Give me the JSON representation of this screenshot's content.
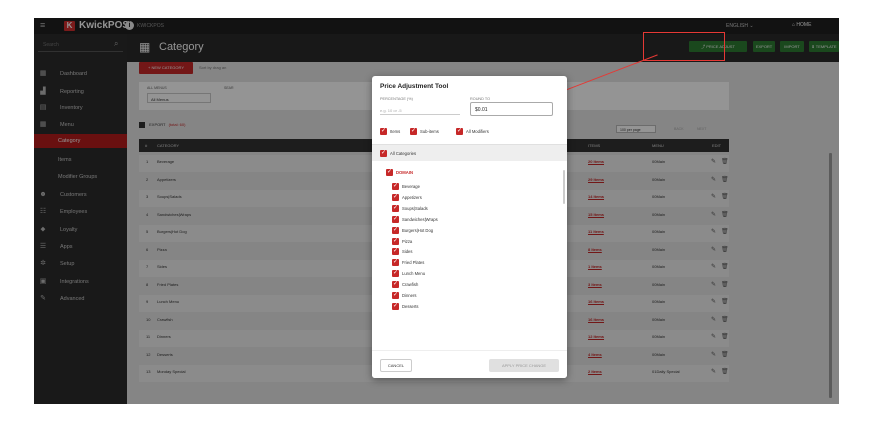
{
  "topbar": {
    "brand": "KwickPOS",
    "store": "KWICKPOS",
    "language": "ENGLISH ⌄",
    "home": "HOME"
  },
  "sidebar": {
    "search_placeholder": "Search",
    "items": [
      {
        "label": "Dashboard",
        "icon": "dashboard-icon"
      },
      {
        "label": "Reporting",
        "icon": "reporting-icon"
      },
      {
        "label": "Inventory",
        "icon": "inventory-icon"
      },
      {
        "label": "Menu",
        "icon": "menu-icon"
      },
      {
        "label": "Category",
        "icon": ""
      },
      {
        "label": "Items",
        "icon": ""
      },
      {
        "label": "Modifier Groups",
        "icon": ""
      },
      {
        "label": "Customers",
        "icon": "customers-icon"
      },
      {
        "label": "Employees",
        "icon": "employees-icon"
      },
      {
        "label": "Loyalty",
        "icon": "loyalty-icon"
      },
      {
        "label": "Apps",
        "icon": "apps-icon"
      },
      {
        "label": "Setup",
        "icon": "setup-icon"
      },
      {
        "label": "Integrations",
        "icon": "integrations-icon"
      },
      {
        "label": "Advanced",
        "icon": "advanced-icon"
      }
    ]
  },
  "header": {
    "title": "Category",
    "buttons": {
      "price_adjust": "PRICE ADJUST",
      "export": "EXPORT",
      "import": "IMPORT",
      "template": "TEMPLATE"
    }
  },
  "content": {
    "new_category": "+ NEW CATEGORY",
    "sort_hint": "Sort by drag an",
    "filter": {
      "all_menus_label": "ALL MENUS",
      "all_menus_value": "All Menus",
      "search_label": "SEAR"
    },
    "export_label": "EXPORT",
    "total": "(total: 60)",
    "per_page": "100 per page",
    "pagination": {
      "back": "BACK",
      "next": "NEXT"
    },
    "table_headers": {
      "num": "#",
      "category": "CATEGORY",
      "items": "ITEMS",
      "menu": "MENU",
      "edit": "EDIT"
    },
    "rows": [
      {
        "num": "1",
        "category": "Beverage",
        "items": "20 Items",
        "menu": "00Main"
      },
      {
        "num": "2",
        "category": "Appetizers",
        "items": "29 Items",
        "menu": "00Main"
      },
      {
        "num": "3",
        "category": "Soups|Salads",
        "items": "14 Items",
        "menu": "00Main"
      },
      {
        "num": "4",
        "category": "Sandwiches|Wraps",
        "items": "15 Items",
        "menu": "00Main"
      },
      {
        "num": "5",
        "category": "Burgers|Hot Dog",
        "items": "11 Items",
        "menu": "00Main"
      },
      {
        "num": "6",
        "category": "Pizza",
        "items": "8 Items",
        "menu": "00Main"
      },
      {
        "num": "7",
        "category": "Sides",
        "items": "1 Items",
        "menu": "00Main"
      },
      {
        "num": "8",
        "category": "Fried Plates",
        "items": "3 Items",
        "menu": "00Main"
      },
      {
        "num": "9",
        "category": "Lunch Menu",
        "items": "16 Items",
        "menu": "00Main"
      },
      {
        "num": "10",
        "category": "Crawfish",
        "items": "16 Items",
        "menu": "00Main"
      },
      {
        "num": "11",
        "category": "Dinners",
        "items": "12 Items",
        "menu": "00Main"
      },
      {
        "num": "12",
        "category": "Desserts",
        "items": "4 Items",
        "menu": "00Main"
      },
      {
        "num": "13",
        "category": "Monday Special",
        "items": "2 Items",
        "menu": "01Daily Special"
      }
    ]
  },
  "modal": {
    "title": "Price Adjustment Tool",
    "percentage_label": "PERCENTAGE (%)",
    "percentage_placeholder": "e.g. 10 or -5",
    "round_label": "ROUND TO",
    "round_value": "$0.01",
    "checks": {
      "items": "Items",
      "sub_items": "Sub-items",
      "all_modifiers": "All Modifiers"
    },
    "all_categories": "All Categories",
    "domain": "DOMAIN",
    "categories": [
      "Beverage",
      "Appetizers",
      "Soups|Salads",
      "Sandwiches|Wraps",
      "Burgers|Hot Dog",
      "Pizza",
      "Sides",
      "Fried Plates",
      "Lunch Menu",
      "Crawfish",
      "Dinners",
      "Desserts"
    ],
    "cancel": "CANCEL",
    "apply": "APPLY PRICE CHANGE"
  },
  "colors": {
    "accent_red": "#c62828",
    "green": "#2e7d32",
    "sidebar": "#2b2b2b",
    "topbar": "#1f1f1f"
  }
}
